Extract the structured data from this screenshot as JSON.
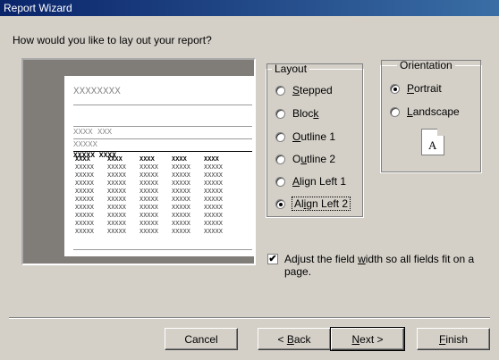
{
  "window": {
    "title": "Report Wizard"
  },
  "question": "How would you like to lay out your report?",
  "preview": {
    "title_placeholder": "XXXXXXXX",
    "group1": "XXXX XXX",
    "group2": "XXXXX",
    "header_row_label": "XXXXX XXXX",
    "column_headers": [
      "XXXX",
      "XXXX",
      "XXXX",
      "XXXX",
      "XXXX"
    ],
    "cell_text": "XXXXX",
    "row_count": 9
  },
  "layout": {
    "legend": "Layout",
    "options": [
      {
        "pre": "",
        "ul": "S",
        "post": "tepped",
        "selected": false
      },
      {
        "pre": "Bloc",
        "ul": "k",
        "post": "",
        "selected": false
      },
      {
        "pre": "",
        "ul": "O",
        "post": "utline 1",
        "selected": false
      },
      {
        "pre": "O",
        "ul": "u",
        "post": "tline 2",
        "selected": false
      },
      {
        "pre": "",
        "ul": "A",
        "post": "lign Left 1",
        "selected": false
      },
      {
        "pre": "Al",
        "ul": "i",
        "post": "gn Left 2",
        "selected": true
      }
    ]
  },
  "orientation": {
    "legend": "Orientation",
    "options": [
      {
        "pre": "",
        "ul": "P",
        "post": "ortrait",
        "selected": true
      },
      {
        "pre": "",
        "ul": "L",
        "post": "andscape",
        "selected": false
      }
    ],
    "icon_letter": "A"
  },
  "adjust": {
    "checked": true,
    "mark": "✔",
    "pre": "Adjust the field ",
    "ul": "w",
    "post": "idth so all fields fit on a page."
  },
  "buttons": {
    "cancel": {
      "label": "Cancel"
    },
    "back": {
      "pre": "< ",
      "ul": "B",
      "post": "ack"
    },
    "next": {
      "pre": "",
      "ul": "N",
      "post": "ext >"
    },
    "finish": {
      "pre": "",
      "ul": "F",
      "post": "inish"
    }
  }
}
